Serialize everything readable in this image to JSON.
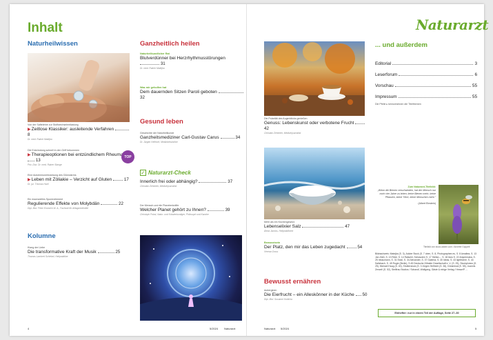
{
  "page_title": "Inhalt",
  "brand": "Naturarzt",
  "sections": {
    "naturheilwissen": "Naturheilwissen",
    "ganzheitlich": "Ganzheitlich heilen",
    "gesund": "Gesund leben",
    "kolumne": "Kolumne",
    "bewusst": "Bewusst ernähren",
    "ausserdem": "... und außerdem"
  },
  "left_col": [
    {
      "kicker": "Von der Saftelehre zur Stoffwechselentlastung",
      "headline": "Zeitlose Klassiker: ausleitende Verfahren",
      "page": "8",
      "author": "Dr. med. Rainer Matejka"
    },
    {
      "kicker": "Die Entzündung schnell in den Griff bekommen",
      "headline": "Therapieoptionen bei entzündlichem Rheuma",
      "page": "13",
      "author": "Priv.-Doz. Dr. med. Rainer Stange",
      "badge": "TOP"
    },
    {
      "kicker": "Eine Autoimmunerkrankung des Dünndarms",
      "headline": "Leben mit Zöliakie – Verzicht auf Gluten",
      "page": "17",
      "author": "Dr. jur. Thomas Hartl"
    },
    {
      "kicker": "Ein essenzielles Spurenelement",
      "headline": "Regulierende Effekte von Molybdän",
      "page": "22",
      "author": "Dipl.-Biol. Peter Emmrich M. A., Fachwirt für Alltagsheilmittel"
    }
  ],
  "kolumne_item": {
    "kicker": "Klang der Liebe",
    "headline": "Die transformative Kraft der Musik",
    "page": "25",
    "author": "Thomas Lambert Schiebel, Heilpraktiker"
  },
  "mid_col": [
    {
      "kicker": "Naturheilkundlicher Rat",
      "headline": "Blutverdünner bei Herzrhythmusstörungen",
      "page": "31",
      "author": "Dr. med. Rainer Matejka"
    },
    {
      "kicker": "Was mir geholfen hat",
      "headline": "Dem dauernden Sitzen Paroli geboten",
      "page": "32",
      "author": ""
    },
    {
      "kicker": "Geschichte der Naturheilkunde",
      "headline": "Ganzheitsmediziner Carl-Gustav Carus",
      "page": "34",
      "author": "Dr. Jürgen Helfricht, Medizinhistoriker"
    },
    {
      "kicker": "",
      "headline": "Innerlich frei oder abhängig?",
      "page": "37",
      "author": "Christian Zehenter, Medizinjournalist"
    },
    {
      "kicker": "Der Mensch und die Planetenkräfte",
      "headline": "Welcher Planet gehört zu Ihnen?",
      "page": "39",
      "author": "Christoph Pobst, Natur- und Kräuterkundiger, Philosoph und Kanzler"
    }
  ],
  "check_label": "Naturarzt-Check",
  "right_col": [
    {
      "kicker": "Die Polarität des Augenblicks genießen",
      "headline": "Genuss: Lebenskunst oder verbotene Frucht",
      "page": "42",
      "author": "Christian Zehenter, Medizinjournalist"
    },
    {
      "kicker": "Mehr als ein Küchengewürz",
      "headline": "Lebenselixier Salz",
      "page": "47",
      "author": "Alexa Jacobs, Heilpraktikerin"
    },
    {
      "kicker": "Bewusstsein",
      "headline": "Der Platz, den mir das Leben zugedacht",
      "page": "54",
      "author": "Verena Gross"
    },
    {
      "kicker": "Auberginen",
      "headline": "Die Eierfrucht – ein Alleskönner in der Küche",
      "page": "50",
      "author": "Dipl.-Biol. Susanne Kodicha"
    }
  ],
  "misc": [
    {
      "label": "Editorial",
      "page": "3"
    },
    {
      "label": "Leserforum",
      "page": "6"
    },
    {
      "label": "Vorschau",
      "page": "55"
    },
    {
      "label": "Impressum",
      "page": "55"
    }
  ],
  "misc_note": "Die Pfeile ▸ kennzeichnen die Titelthemen",
  "quote": {
    "kicker": "Zum Naturarzt-Titelbild:",
    "text": "„Wenn die Bienen verschwinden, hat der Mensch nur noch vier Jahre zu leben; keine Bienen mehr, keine Pflanzen, keine Tiere, keine Menschen mehr.\"",
    "author": "(Albert Einstein)",
    "credit": "Titelbild von stock.adobe.com / Annette Goppelt"
  },
  "credits_text": "Bildnachweis: Matejka (S. 3), Adobe Stock (S. 7 oben, S. 8, Photographee.eu, S. 8 Amaltea, S. 13 Jan Jirků, S. 13 Rinkl. S. 14 Ratschil, Schrauden S. 17 Stefan..., S. 18 tiaro S. 22 Ampermaka, S. 25 mhaumann, S. 31 Stokl, S. 34 Alexander, S. 37 Gaiema, S. 40 Ideas, S. 43 lightframe, S. 44 Saltzbach, S. 45 Rogie (Berlin), S.45 Deutsche Zöliakie Gesellschaft e. V. (S. 29), Stockphotos (S. 25), Michael Haug (S. 40), Shutterstock (S. 3 Jürgen Helfricht (S. 36), Dreaminal (S. 55), Joannis Zenzeli (S. 52), Stellfrau Studios / Schandl, Wolfgang, Gäste & einige Verlag / Hesse/P. ...",
  "box_note": "Einhefter: nur in einem Teil der Auflage, Seite 27–30",
  "footer": {
    "left_page": "4",
    "left_issue": "5/2024",
    "left_brand": "Naturarzt",
    "right_brand": "Naturarzt",
    "right_issue": "5/2024",
    "right_page": "5"
  },
  "colors": {
    "green": "#6aab2d",
    "red": "#c8323c",
    "blue": "#2a6db0"
  }
}
